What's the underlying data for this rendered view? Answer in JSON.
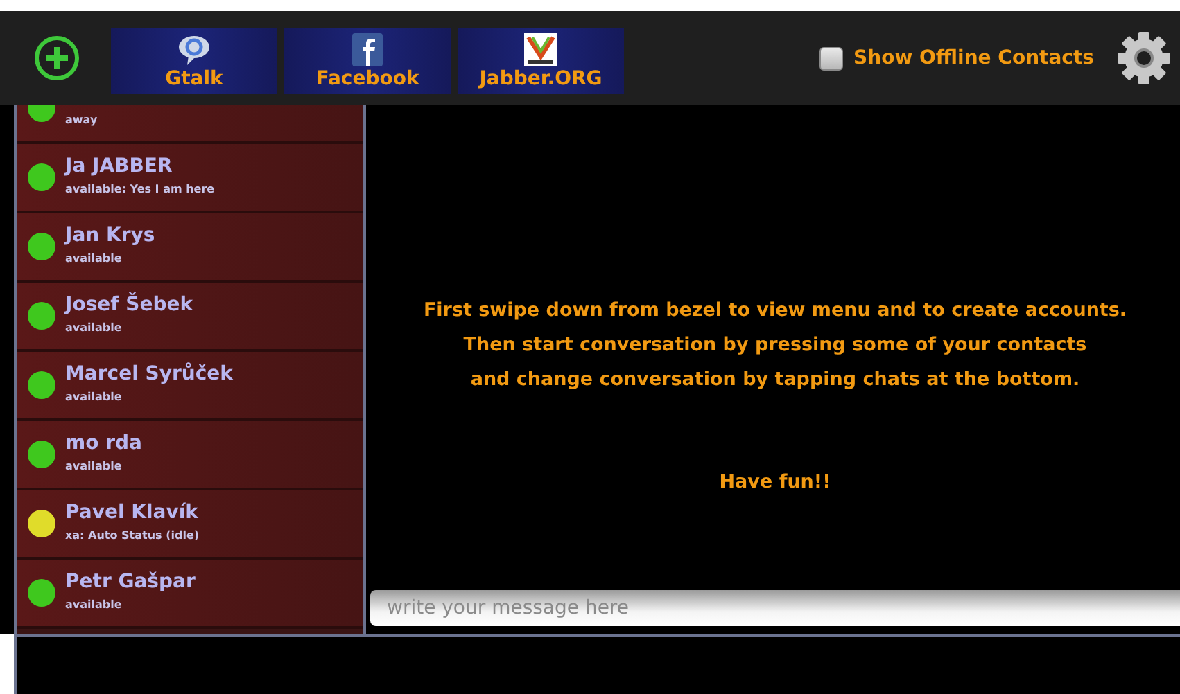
{
  "toolbar": {
    "accounts": [
      {
        "label": "Gtalk",
        "kind": "gtalk"
      },
      {
        "label": "Facebook",
        "kind": "facebook"
      },
      {
        "label": "Jabber.ORG",
        "kind": "jabber"
      }
    ],
    "offline_toggle": {
      "label": "Show Offline Contacts",
      "checked": false
    }
  },
  "contacts": [
    {
      "status": "away",
      "color": "#3fc81e"
    },
    {
      "name": "Ja JABBER",
      "status": "available: Yes I am here",
      "color": "#3fc81e"
    },
    {
      "name": "Jan Krys",
      "status": "available",
      "color": "#3fc81e"
    },
    {
      "name": "Josef Šebek",
      "status": "available",
      "color": "#3fc81e"
    },
    {
      "name": "Marcel Syrůček",
      "status": "available",
      "color": "#3fc81e"
    },
    {
      "name": "mo rda",
      "status": "available",
      "color": "#3fc81e"
    },
    {
      "name": "Pavel Klavík",
      "status": "xa: Auto Status (idle)",
      "color": "#e0dc2a"
    },
    {
      "name": "Petr Gašpar",
      "status": "available",
      "color": "#3fc81e"
    }
  ],
  "chat": {
    "instructions": [
      "First swipe down from bezel to view menu and to create accounts.",
      "Then start conversation by pressing some of your contacts",
      "and change conversation by tapping chats at the bottom."
    ],
    "greeting": "Have fun!!",
    "message_field": {
      "placeholder": "write your message here"
    }
  }
}
